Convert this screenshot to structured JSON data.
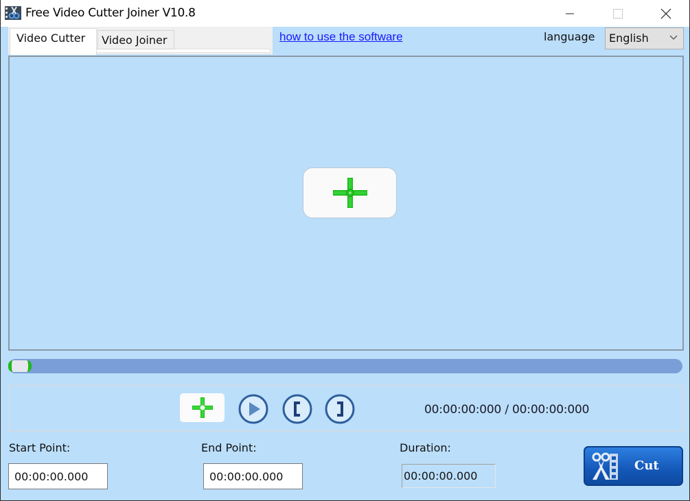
{
  "window": {
    "title": "Free Video Cutter Joiner V10.8",
    "controls": [
      "minimize",
      "maximize",
      "close"
    ]
  },
  "tabs": [
    {
      "label": "Video Cutter",
      "active": true
    },
    {
      "label": "Video Joiner",
      "active": false
    }
  ],
  "header": {
    "help_link": "how to use the software",
    "language_label": "language",
    "language_selected": "English"
  },
  "player": {
    "add_video_icon": "green-plus-icon",
    "seek_position": 0,
    "time_current": "00:00:00:000",
    "time_separator": "/",
    "time_total": "00:00:00:000",
    "time_display": "00:00:00:000 / 00:00:00:000"
  },
  "controls": {
    "add_icon": "green-plus-icon",
    "play_icon": "play-icon",
    "mark_in_icon": "bracket-open-icon",
    "mark_out_icon": "bracket-close-icon"
  },
  "fields": {
    "start_label": "Start Point:",
    "start_value": "00:00:00.000",
    "end_label": "End Point:",
    "end_value": "00:00:00.000",
    "duration_label": "Duration:",
    "duration_value": "00:00:00.000"
  },
  "actions": {
    "cut_label": "Cut"
  },
  "colors": {
    "background": "#bbdefa",
    "seek_track": "#7a9fd8",
    "accent_green": "#20c020",
    "cut_button": "#1458b8",
    "link": "#1a1aff"
  }
}
